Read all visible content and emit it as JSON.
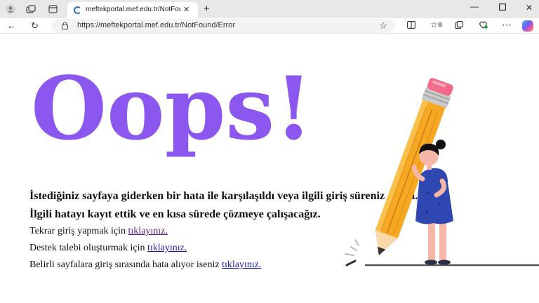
{
  "browser": {
    "tab_title": "meftekportal.mef.edu.tr/NotFound",
    "url": "https://meftekportal.mef.edu.tr/NotFound/Error"
  },
  "page": {
    "headline": "Oops!",
    "line1": "İstediğiniz sayfaya giderken bir hata ile karşılaşıldı veya ilgili giriş süreniz doldu.",
    "line2": "İlgili hatayı kayıt ettik ve en kısa sürede çözmeye çalışacağız.",
    "link_rows": [
      {
        "text": "Tekrar giriş yapmak için ",
        "link": "tıklayınız."
      },
      {
        "text": "Destek talebi oluşturmak için ",
        "link": "tıklayınız."
      },
      {
        "text": "Belirli sayfalara giriş sırasında hata alıyor iseniz ",
        "link": "tıklayınız."
      }
    ]
  },
  "colors": {
    "headline": "#8b57ef",
    "link_visited": "#551a8b",
    "link": "#1a1aa6"
  },
  "icons": [
    "profile-icon",
    "workspaces-icon",
    "tab-actions-icon",
    "favicon-icon",
    "close-icon",
    "new-tab-icon",
    "minimize-icon",
    "maximize-icon",
    "window-close-icon",
    "back-icon",
    "refresh-icon",
    "lock-icon",
    "favorite-star-icon",
    "split-screen-icon",
    "favorites-icon",
    "collections-icon",
    "browser-essentials-icon",
    "more-icon",
    "copilot-icon"
  ]
}
